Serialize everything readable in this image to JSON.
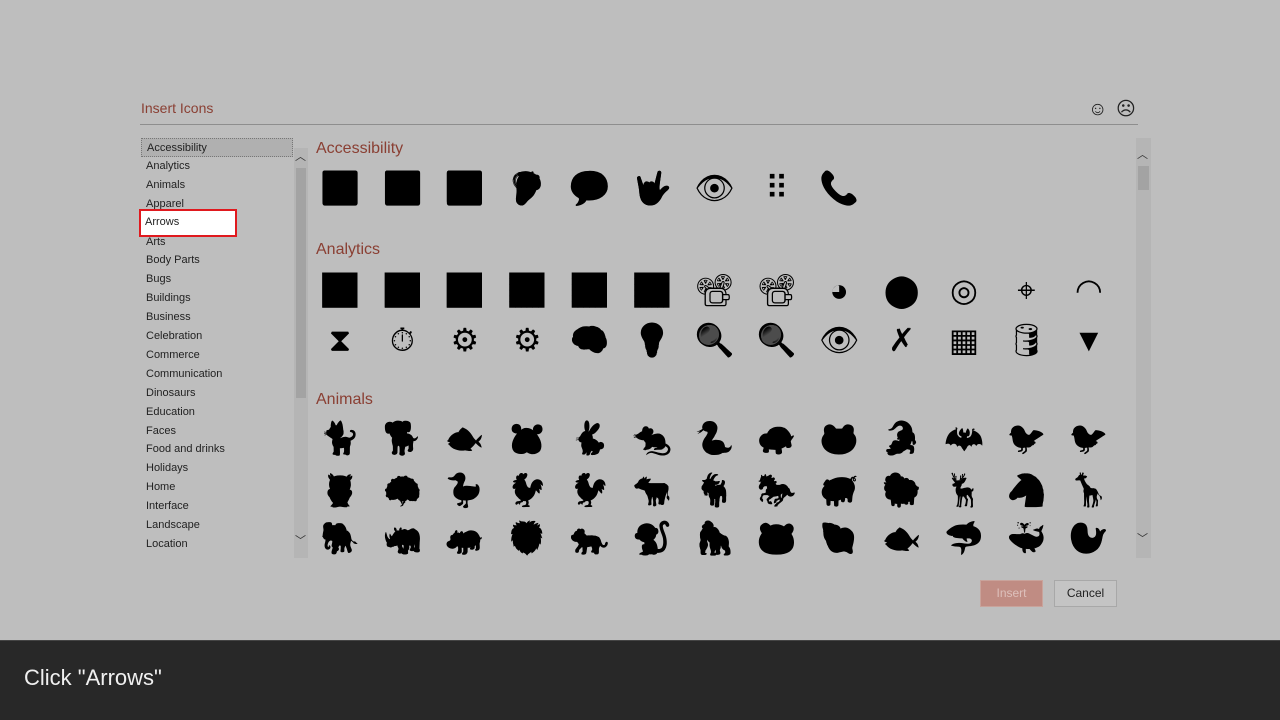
{
  "dialog": {
    "title": "Insert Icons",
    "feedback": {
      "smile_icon": "☺",
      "frown_icon": "☹"
    }
  },
  "categories": [
    "Accessibility",
    "Analytics",
    "Animals",
    "Apparel",
    "Arrows",
    "Arts",
    "Body Parts",
    "Bugs",
    "Buildings",
    "Business",
    "Celebration",
    "Commerce",
    "Communication",
    "Dinosaurs",
    "Education",
    "Faces",
    "Food and drinks",
    "Holidays",
    "Home",
    "Interface",
    "Landscape",
    "Location"
  ],
  "selected_category": "Accessibility",
  "highlighted_category": "Arrows",
  "highlight_color": "#e0191e",
  "sections": [
    {
      "title": "Accessibility",
      "rows": [
        [
          "♿",
          "♿",
          "🚻",
          "🦻",
          "💬",
          "🤟",
          "👁",
          "⠿",
          "📞"
        ]
      ]
    },
    {
      "title": "Analytics",
      "rows": [
        [
          "📊",
          "📊",
          "📊",
          "📉",
          "📈",
          "📈",
          "📽",
          "📽",
          "◕",
          "⬤",
          "◎",
          "⌖",
          "◠"
        ],
        [
          "⧗",
          "⏱",
          "⚙",
          "⚙",
          "🧠",
          "💡",
          "🔍",
          "🔍",
          "👁",
          "✗",
          "▦",
          "🛢",
          "▼"
        ]
      ]
    },
    {
      "title": "Animals",
      "rows": [
        [
          "🐈",
          "🐕",
          "🐟",
          "🐹",
          "🐇",
          "🐀",
          "🐍",
          "🐢",
          "🐸",
          "🐊",
          "🦇",
          "🐦",
          "🐦"
        ],
        [
          "🦉",
          "🦚",
          "🦆",
          "🐓",
          "🐓",
          "🐄",
          "🐐",
          "🐎",
          "🐖",
          "🐑",
          "🦌",
          "🦓",
          "🦒"
        ],
        [
          "🐘",
          "🦏",
          "🦛",
          "🦁",
          "🐅",
          "🐒",
          "🦍",
          "🐼",
          "🐚",
          "🐟",
          "🦈",
          "🐳",
          "🦭"
        ]
      ]
    }
  ],
  "buttons": {
    "insert": "Insert",
    "cancel": "Cancel"
  },
  "caption": "Click \"Arrows\""
}
